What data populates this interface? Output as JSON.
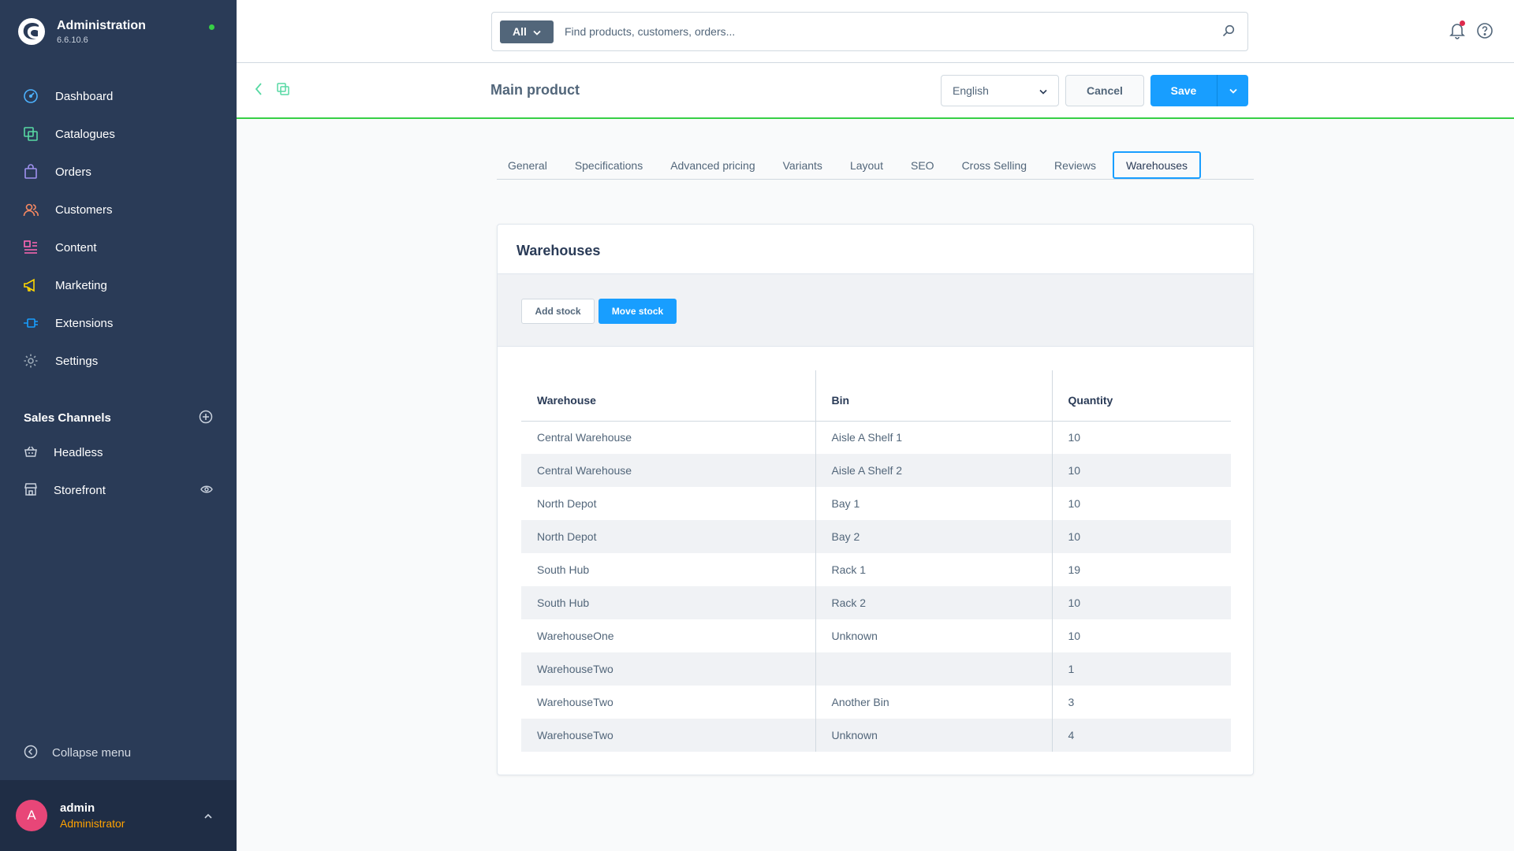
{
  "app": {
    "title": "Administration",
    "version": "6.6.10.6"
  },
  "sidebar": {
    "items": [
      {
        "label": "Dashboard",
        "icon": "dashboard-icon",
        "color": "#4db3ff"
      },
      {
        "label": "Catalogues",
        "icon": "catalogue-icon",
        "color": "#57d9a3"
      },
      {
        "label": "Orders",
        "icon": "orders-icon",
        "color": "#a092f0"
      },
      {
        "label": "Customers",
        "icon": "customers-icon",
        "color": "#f88962"
      },
      {
        "label": "Content",
        "icon": "content-icon",
        "color": "#ff68b4"
      },
      {
        "label": "Marketing",
        "icon": "marketing-icon",
        "color": "#ffd700"
      },
      {
        "label": "Extensions",
        "icon": "extensions-icon",
        "color": "#189eff"
      },
      {
        "label": "Settings",
        "icon": "settings-icon",
        "color": "#9aa8b5"
      }
    ],
    "sales_channels_title": "Sales Channels",
    "sales_channels": [
      {
        "label": "Headless"
      },
      {
        "label": "Storefront"
      }
    ],
    "collapse_label": "Collapse menu"
  },
  "user": {
    "initial": "A",
    "name": "admin",
    "role": "Administrator"
  },
  "search": {
    "type_label": "All",
    "placeholder": "Find products, customers, orders..."
  },
  "smartbar": {
    "title": "Main product",
    "language": "English",
    "cancel_label": "Cancel",
    "save_label": "Save"
  },
  "tabs": [
    {
      "label": "General"
    },
    {
      "label": "Specifications"
    },
    {
      "label": "Advanced pricing"
    },
    {
      "label": "Variants"
    },
    {
      "label": "Layout"
    },
    {
      "label": "SEO"
    },
    {
      "label": "Cross Selling"
    },
    {
      "label": "Reviews"
    },
    {
      "label": "Warehouses",
      "active": true
    }
  ],
  "card": {
    "title": "Warehouses",
    "add_stock_label": "Add stock",
    "move_stock_label": "Move stock"
  },
  "table": {
    "columns": [
      "Warehouse",
      "Bin",
      "Quantity"
    ],
    "rows": [
      [
        "Central Warehouse",
        "Aisle A Shelf 1",
        "10"
      ],
      [
        "Central Warehouse",
        "Aisle A Shelf 2",
        "10"
      ],
      [
        "North Depot",
        "Bay 1",
        "10"
      ],
      [
        "North Depot",
        "Bay 2",
        "10"
      ],
      [
        "South Hub",
        "Rack 1",
        "19"
      ],
      [
        "South Hub",
        "Rack 2",
        "10"
      ],
      [
        "WarehouseOne",
        "Unknown",
        "10"
      ],
      [
        "WarehouseTwo",
        "",
        "1"
      ],
      [
        "WarehouseTwo",
        "Another Bin",
        "3"
      ],
      [
        "WarehouseTwo",
        "Unknown",
        "4"
      ]
    ]
  }
}
